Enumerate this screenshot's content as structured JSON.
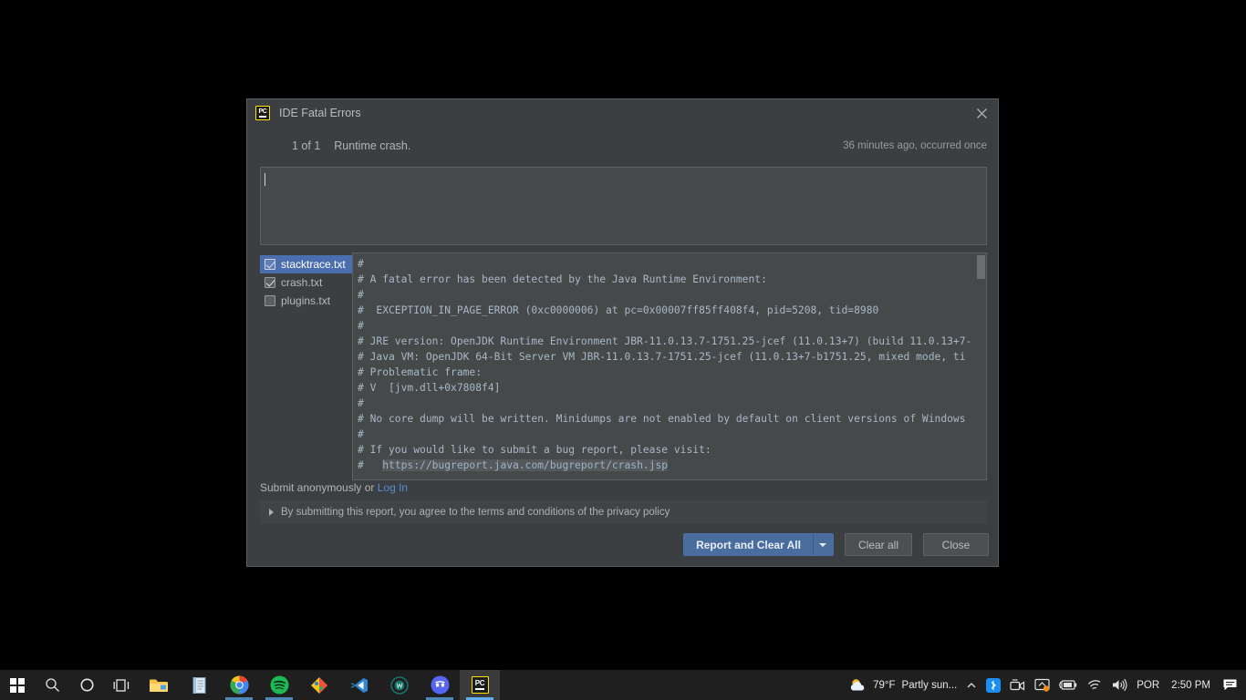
{
  "dialog": {
    "icon_name": "pycharm-icon",
    "title": "IDE Fatal Errors",
    "close_label": "✕",
    "counter": "1 of 1",
    "crash_label": "Runtime crash.",
    "timing": "36 minutes ago, occurred once",
    "comment_placeholder": "",
    "comment_value": "",
    "files": [
      {
        "name": "stacktrace.txt",
        "checked": true,
        "selected": true
      },
      {
        "name": "crash.txt",
        "checked": true,
        "selected": false
      },
      {
        "name": "plugins.txt",
        "checked": false,
        "selected": false
      }
    ],
    "stacktrace_lines": [
      "#",
      "# A fatal error has been detected by the Java Runtime Environment:",
      "#",
      "#  EXCEPTION_IN_PAGE_ERROR (0xc0000006) at pc=0x00007ff85ff408f4, pid=5208, tid=8980",
      "#",
      "# JRE version: OpenJDK Runtime Environment JBR-11.0.13.7-1751.25-jcef (11.0.13+7) (build 11.0.13+7-",
      "# Java VM: OpenJDK 64-Bit Server VM JBR-11.0.13.7-1751.25-jcef (11.0.13+7-b1751.25, mixed mode, ti",
      "# Problematic frame:",
      "# V  [jvm.dll+0x7808f4]",
      "#",
      "# No core dump will be written. Minidumps are not enabled by default on client versions of Windows",
      "#",
      "# If you would like to submit a bug report, please visit:"
    ],
    "stacktrace_url_prefix": "#   ",
    "stacktrace_url": "https://bugreport.java.com/bugreport/crash.jsp",
    "submit_prefix": "Submit anonymously or ",
    "login_label": "Log In",
    "disclaimer": "By submitting this report, you agree to the terms and conditions of the privacy policy",
    "buttons": {
      "report_and_clear_all": "Report and Clear All",
      "clear_all": "Clear all",
      "close": "Close"
    }
  },
  "taskbar": {
    "items": [
      {
        "icon": "windows-start-icon",
        "active": false,
        "running": false
      },
      {
        "icon": "search-icon",
        "active": false,
        "running": false
      },
      {
        "icon": "cortana-icon",
        "active": false,
        "running": false
      },
      {
        "icon": "task-view-icon",
        "active": false,
        "running": false
      },
      {
        "icon": "file-explorer-icon",
        "active": false,
        "running": false
      },
      {
        "icon": "notepad-icon",
        "active": false,
        "running": false
      },
      {
        "icon": "chrome-icon",
        "active": false,
        "running": true
      },
      {
        "icon": "spotify-icon",
        "active": false,
        "running": true
      },
      {
        "icon": "paint-icon",
        "active": false,
        "running": false
      },
      {
        "icon": "vscode-icon",
        "active": false,
        "running": false
      },
      {
        "icon": "wamp-icon",
        "active": false,
        "running": false
      },
      {
        "icon": "discord-icon",
        "active": false,
        "running": true
      },
      {
        "icon": "pycharm-icon",
        "active": true,
        "running": true
      }
    ],
    "tray": {
      "weather_temp": "79°F",
      "weather_desc": "Partly sun...",
      "chevron": "show-hidden-icons",
      "icons": [
        "bluetooth-icon",
        "webcam-icon",
        "screen-share-icon",
        "battery-icon",
        "wifi-icon",
        "volume-icon"
      ],
      "language": "POR",
      "clock": "2:50 PM",
      "notifications": "notification-icon"
    }
  },
  "colors": {
    "dialog_bg": "#3c3f41",
    "panel_bg": "#45494a",
    "accent_blue": "#4b6eaf",
    "link_blue": "#588cd1",
    "text_primary": "#b4b4b4",
    "code_text": "#a9b7c6",
    "taskbar_bg": "#1f1f1f"
  }
}
